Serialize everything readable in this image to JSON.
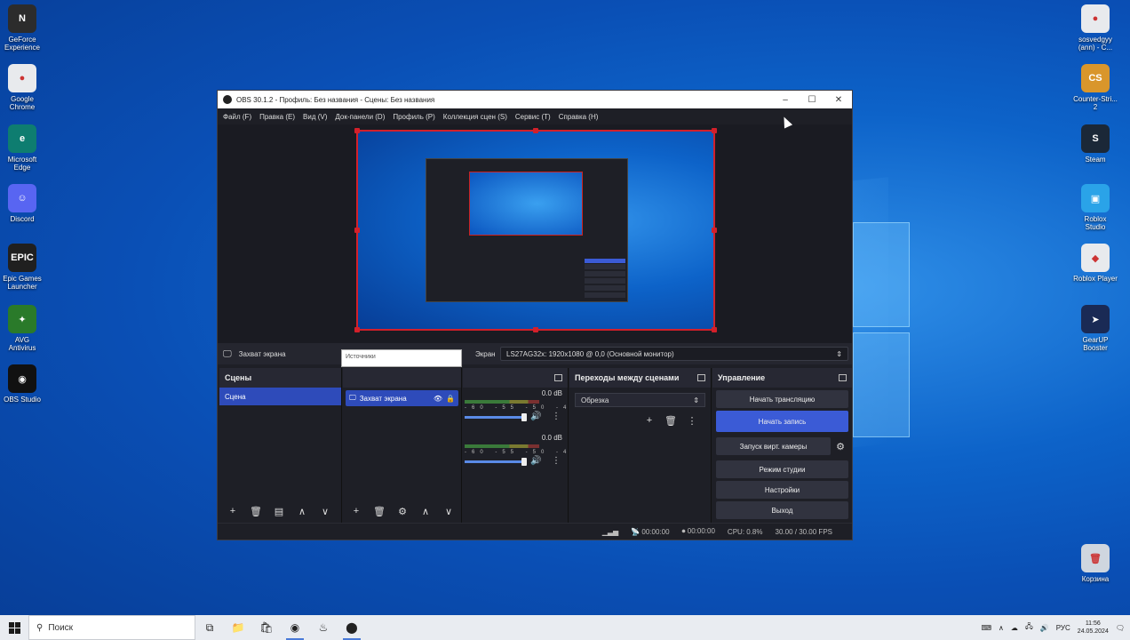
{
  "desktop": {
    "left_icons": [
      {
        "name": "geforce",
        "label": "GeForce\nExperience",
        "color": "#2c2c2c",
        "glyph": "N"
      },
      {
        "name": "chrome",
        "label": "Google\nChrome",
        "color": "#e8eaed",
        "glyph": "●"
      },
      {
        "name": "edge",
        "label": "Microsoft\nEdge",
        "color": "#0e7d70",
        "glyph": "e"
      },
      {
        "name": "discord",
        "label": "Discord",
        "color": "#5865f2",
        "glyph": "☺"
      },
      {
        "name": "epic",
        "label": "Epic Games\nLauncher",
        "color": "#202020",
        "glyph": "EPIC"
      },
      {
        "name": "avast",
        "label": "AVG\nAntivirus",
        "color": "#2a7a2a",
        "glyph": "✦"
      },
      {
        "name": "obs",
        "label": "OBS Studio",
        "color": "#111111",
        "glyph": "◉"
      }
    ],
    "right_icons": [
      {
        "name": "chrome-profile",
        "label": "sosvedgyy\n(ann) - C...",
        "color": "#e8eaed",
        "glyph": "●"
      },
      {
        "name": "counter-strike",
        "label": "Counter-Stri...\n2",
        "color": "#d9962b",
        "glyph": "CS"
      },
      {
        "name": "steam",
        "label": "Steam",
        "color": "#1b2838",
        "glyph": "S"
      },
      {
        "name": "roblox-studio",
        "label": "Roblox\nStudio",
        "color": "#2aa3e8",
        "glyph": "▣"
      },
      {
        "name": "roblox-player",
        "label": "Roblox Player",
        "color": "#e8eaed",
        "glyph": "◆"
      },
      {
        "name": "gearup",
        "label": "GearUP\nBooster",
        "color": "#1a2a55",
        "glyph": "➤"
      },
      {
        "name": "recycle-bin",
        "label": "Корзина",
        "color": "#cfd6df",
        "glyph": "🗑"
      }
    ]
  },
  "obs": {
    "title": "OBS 30.1.2 - Профиль: Без названия - Сцены: Без названия",
    "menu": [
      "Файл (F)",
      "Правка (E)",
      "Вид (V)",
      "Док-панели (D)",
      "Профиль (P)",
      "Коллекция сцен (S)",
      "Сервис (T)",
      "Справка (H)"
    ],
    "source_bar": {
      "selected_source": "Захват экрана",
      "display_label": "Экран",
      "display_value": "LS27AG32x: 1920x1080 @ 0,0 (Основной монитор)"
    },
    "tooltip": "Источники",
    "scenes": {
      "title": "Сцены",
      "items": [
        "Сцена"
      ]
    },
    "sources": {
      "items": [
        "Захват экрана"
      ]
    },
    "mixer": {
      "channels": [
        {
          "db": "0.0 dB",
          "ticks": "-60 -55 -50 -45 -40 -35 -30 -25 -20 -15 -10 -5 0"
        },
        {
          "db": "0.0 dB",
          "ticks": "-60 -55 -50 -45 -40 -35 -30 -25 -20 -15 -10 -5 0"
        }
      ]
    },
    "transitions": {
      "title": "Переходы между сценами",
      "selected": "Обрезка"
    },
    "controls": {
      "title": "Управление",
      "start_stream": "Начать трансляцию",
      "start_record": "Начать запись",
      "virtual_cam": "Запуск вирт. камеры",
      "studio_mode": "Режим студии",
      "settings": "Настройки",
      "exit": "Выход"
    },
    "status": {
      "stream_time": "00:00:00",
      "record_time": "00:00:00",
      "cpu": "CPU: 0.8%",
      "fps": "30.00 / 30.00 FPS"
    }
  },
  "taskbar": {
    "search_placeholder": "Поиск",
    "language": "РУС",
    "time": "11:56",
    "date": "24.05.2024"
  },
  "colors": {
    "accent": "#3b5bd6",
    "selection": "#d3202a"
  }
}
